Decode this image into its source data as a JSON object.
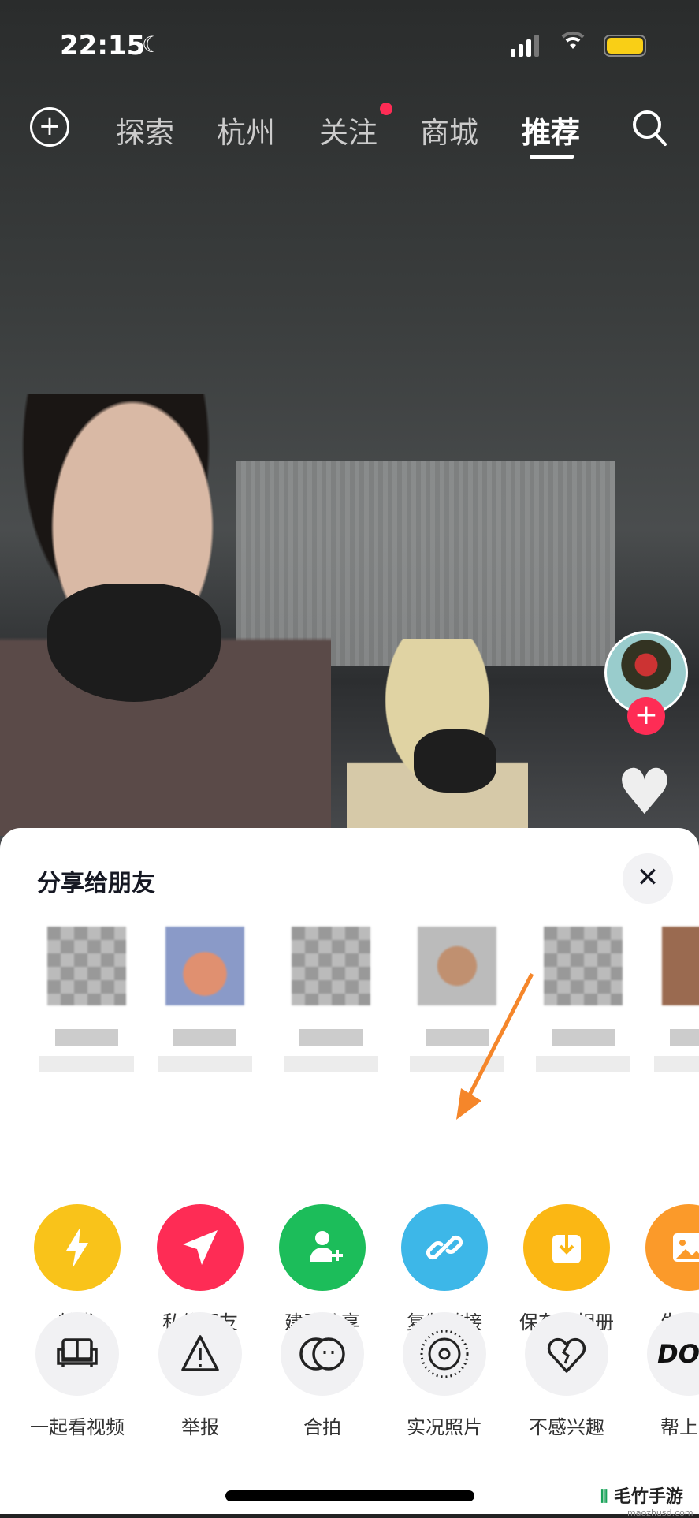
{
  "status_bar": {
    "time": "22:15"
  },
  "top_nav": {
    "tabs": [
      {
        "label": "探索"
      },
      {
        "label": "杭州"
      },
      {
        "label": "关注",
        "badge": true
      },
      {
        "label": "商城"
      },
      {
        "label": "推荐",
        "active": true
      }
    ]
  },
  "share_sheet": {
    "title": "分享给朋友",
    "actions": [
      {
        "label": "转发",
        "icon": "lightning-icon",
        "color": "#f9c31a"
      },
      {
        "label": "私信朋友",
        "icon": "paper-plane-icon",
        "color": "#fe2c55"
      },
      {
        "label": "建群分享",
        "icon": "group-add-icon",
        "color": "#1cbd5a"
      },
      {
        "label": "复制链接",
        "icon": "link-icon",
        "color": "#3db7e8"
      },
      {
        "label": "保存至相册",
        "icon": "download-icon",
        "color": "#fbb714"
      },
      {
        "label": "生成图",
        "icon": "image-icon",
        "color": "#fb9a2a"
      }
    ],
    "more": [
      {
        "label": "一起看视频",
        "icon": "sofa-icon"
      },
      {
        "label": "举报",
        "icon": "warning-icon"
      },
      {
        "label": "合拍",
        "icon": "duet-icon"
      },
      {
        "label": "实况照片",
        "icon": "live-photo-icon"
      },
      {
        "label": "不感兴趣",
        "icon": "broken-heart-icon"
      },
      {
        "label": "帮上热",
        "icon": "dou-icon"
      }
    ]
  },
  "watermark": {
    "text": "毛竹手游",
    "sub": "maozhusd.com"
  }
}
